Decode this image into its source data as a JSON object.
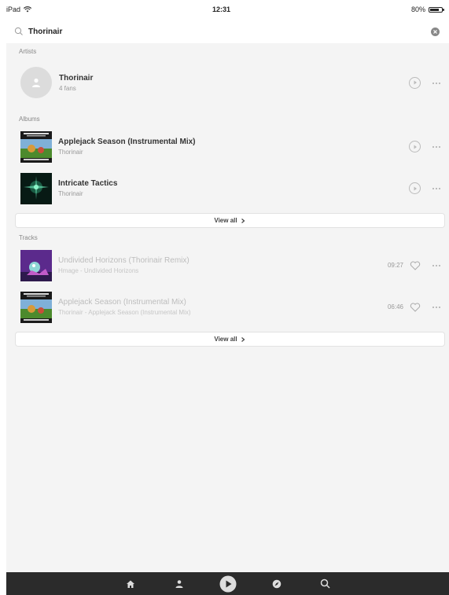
{
  "status_bar": {
    "device": "iPad",
    "time": "12:31",
    "battery": "80%",
    "battery_level": 0.8
  },
  "search": {
    "query": "Thorinair",
    "icon": "search-icon",
    "clear_icon": "clear-icon"
  },
  "artists": {
    "label": "Artists",
    "items": [
      {
        "name": "Thorinair",
        "fans": "4 fans"
      }
    ]
  },
  "albums": {
    "label": "Albums",
    "items": [
      {
        "title": "Applejack Season (Instrumental Mix)",
        "artist": "Thorinair"
      },
      {
        "title": "Intricate Tactics",
        "artist": "Thorinair"
      }
    ],
    "view_all": "View all"
  },
  "tracks": {
    "label": "Tracks",
    "items": [
      {
        "title": "Undivided Horizons (Thorinair Remix)",
        "subtitle": "Hmage - Undivided Horizons",
        "duration": "09:27"
      },
      {
        "title": "Applejack Season (Instrumental Mix)",
        "subtitle": "Thorinair - Applejack Season (Instrumental Mix)",
        "duration": "06:46"
      }
    ],
    "view_all": "View all"
  },
  "tab_bar": {
    "items": [
      "home-icon",
      "profile-icon",
      "play-icon",
      "explore-icon",
      "search-icon"
    ],
    "active": "play-icon"
  },
  "colors": {
    "accent": "#2b2b2b",
    "background": "#f4f4f4"
  }
}
